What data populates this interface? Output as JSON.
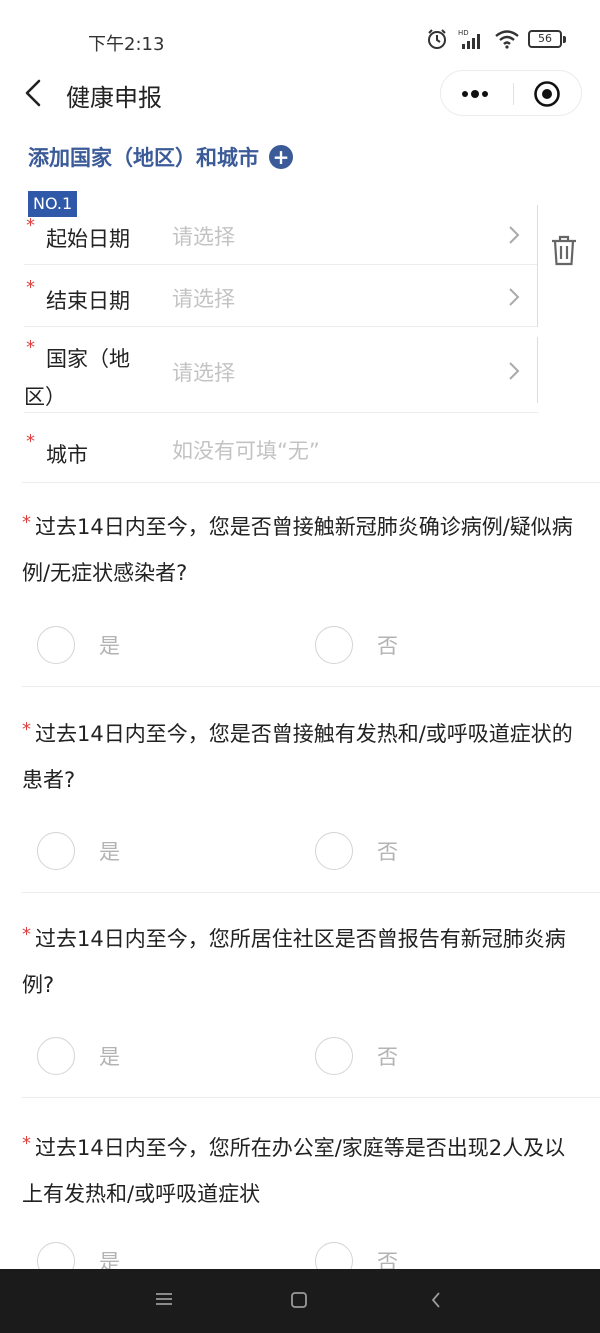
{
  "status_bar": {
    "time": "下午2:13",
    "battery": "56",
    "icons": [
      "alarm-icon",
      "hd-signal-icon",
      "wifi-icon",
      "battery-icon"
    ]
  },
  "nav": {
    "title": "健康申报",
    "icons": [
      "back-icon",
      "more-icon",
      "close-miniprogram-icon"
    ]
  },
  "add_country": {
    "label": "添加国家（地区）和城市",
    "icon": "+"
  },
  "entry": {
    "badge": "NO.1",
    "fields": [
      {
        "label": "起始日期",
        "placeholder": "请选择"
      },
      {
        "label": "结束日期",
        "placeholder": "请选择"
      },
      {
        "label_line1": "国家（地",
        "label_line2": "区）",
        "placeholder": "请选择"
      },
      {
        "label": "城市",
        "placeholder": "如没有可填“无”"
      }
    ]
  },
  "questions": [
    {
      "text": "过去14日内至今，您是否曾接触新冠肺炎确诊病例/疑似病例/无症状感染者?",
      "options": [
        "是",
        "否"
      ]
    },
    {
      "text": "过去14日内至今，您是否曾接触有发热和/或呼吸道症状的患者?",
      "options": [
        "是",
        "否"
      ]
    },
    {
      "text": "过去14日内至今，您所居住社区是否曾报告有新冠肺炎病例?",
      "options": [
        "是",
        "否"
      ]
    },
    {
      "text": "过去14日内至今，您所在办公室/家庭等是否出现2人及以上有发热和/或呼吸道症状",
      "options": [
        "是",
        "否"
      ]
    }
  ],
  "required_mark": "*",
  "colors": {
    "accent": "#3a5a98",
    "badge": "#2f58a8",
    "required": "#e04040",
    "placeholder": "#c3c3c3"
  }
}
